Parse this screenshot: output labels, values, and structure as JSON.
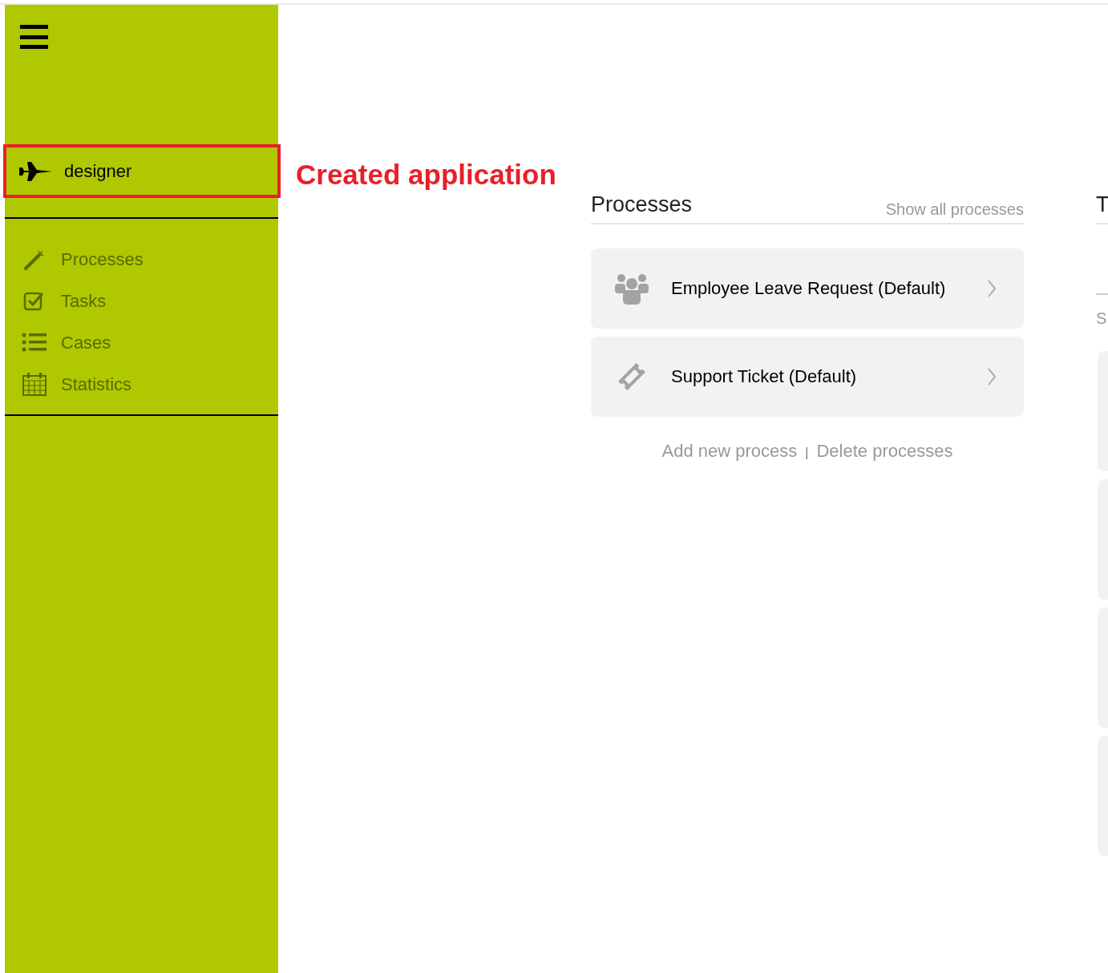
{
  "sidebar": {
    "app": {
      "label": "designer",
      "highlighted": true
    },
    "items": [
      {
        "label": "Processes",
        "kind": "wand"
      },
      {
        "label": "Tasks",
        "kind": "check"
      },
      {
        "label": "Cases",
        "kind": "list"
      },
      {
        "label": "Statistics",
        "kind": "calendar"
      }
    ]
  },
  "annotation": "Created application",
  "processes": {
    "title": "Processes",
    "show_all": "Show all processes",
    "items": [
      {
        "label": "Employee Leave Request (Default)",
        "kind": "users"
      },
      {
        "label": "Support Ticket (Default)",
        "kind": "ticket"
      }
    ],
    "add": "Add new process",
    "separator": "|",
    "delete": "Delete processes"
  },
  "column_3": {
    "title": "T",
    "text": "S"
  }
}
